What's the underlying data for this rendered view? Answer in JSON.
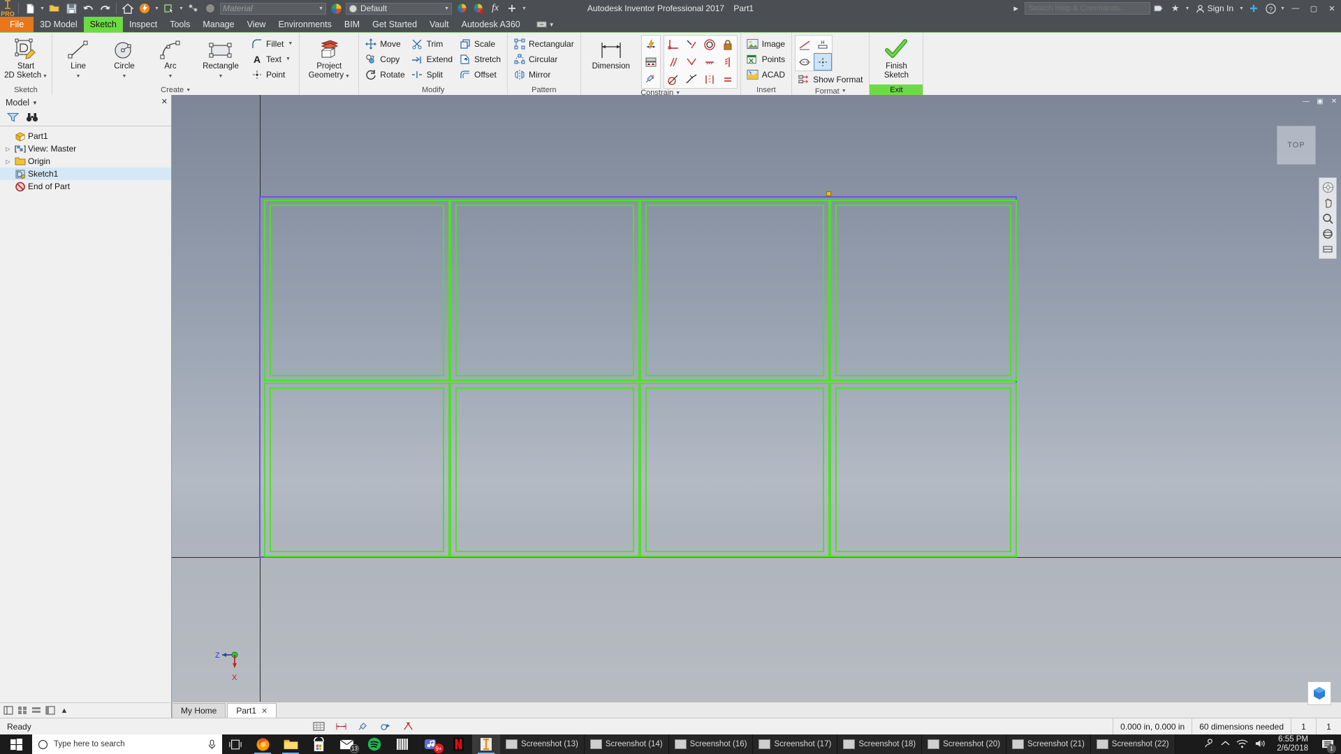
{
  "app": {
    "title": "Autodesk Inventor Professional 2017",
    "document": "Part1",
    "logo": "PRO"
  },
  "quick_access": {
    "icons": [
      "new-document-icon",
      "open-folder-icon",
      "save-icon",
      "undo-icon",
      "redo-icon",
      "home-icon",
      "update-icon",
      "select-icon",
      "constraint-icon",
      "appearance-sphere-icon"
    ],
    "material_placeholder": "Material",
    "appearance_value": "Default",
    "fx_label": "fx"
  },
  "search": {
    "placeholder": "Search Help & Commands...",
    "sign_in": "Sign In"
  },
  "tabs": [
    {
      "label": "File",
      "state": "file"
    },
    {
      "label": "3D Model",
      "state": "normal"
    },
    {
      "label": "Sketch",
      "state": "active"
    },
    {
      "label": "Inspect",
      "state": "normal"
    },
    {
      "label": "Tools",
      "state": "normal"
    },
    {
      "label": "Manage",
      "state": "normal"
    },
    {
      "label": "View",
      "state": "normal"
    },
    {
      "label": "Environments",
      "state": "normal"
    },
    {
      "label": "BIM",
      "state": "normal"
    },
    {
      "label": "Get Started",
      "state": "normal"
    },
    {
      "label": "Vault",
      "state": "normal"
    },
    {
      "label": "Autodesk A360",
      "state": "normal"
    }
  ],
  "ribbon": {
    "groups": {
      "sketch": {
        "label": "Sketch",
        "start_2d_sketch": "Start\n2D Sketch",
        "start_line1": "Start",
        "start_line2": "2D Sketch"
      },
      "create": {
        "label": "Create",
        "line": "Line",
        "circle": "Circle",
        "arc": "Arc",
        "rectangle": "Rectangle",
        "fillet": "Fillet",
        "text": "Text",
        "point": "Point"
      },
      "project": {
        "line1": "Project",
        "line2": "Geometry"
      },
      "modify": {
        "label": "Modify",
        "move": "Move",
        "copy": "Copy",
        "rotate": "Rotate",
        "trim": "Trim",
        "extend": "Extend",
        "split": "Split",
        "scale": "Scale",
        "stretch": "Stretch",
        "offset": "Offset"
      },
      "pattern": {
        "label": "Pattern",
        "rectangular": "Rectangular",
        "circular": "Circular",
        "mirror": "Mirror"
      },
      "constrain": {
        "label": "Constrain",
        "dimension": "Dimension"
      },
      "insert": {
        "label": "Insert",
        "image": "Image",
        "points": "Points",
        "acad": "ACAD"
      },
      "format": {
        "label": "Format",
        "show_format": "Show Format"
      },
      "exit": {
        "label": "Exit",
        "finish_line1": "Finish",
        "finish_line2": "Sketch"
      }
    }
  },
  "browser": {
    "title": "Model",
    "filter_icon": "filter-icon",
    "find_icon": "binoculars-icon",
    "tree": [
      {
        "label": "Part1",
        "icon": "part-cube-icon",
        "indent": 0,
        "expandable": false,
        "selected": false
      },
      {
        "label": "View: Master",
        "icon": "view-master-icon",
        "indent": 0,
        "expandable": true,
        "selected": false
      },
      {
        "label": "Origin",
        "icon": "folder-icon",
        "indent": 0,
        "expandable": true,
        "selected": false
      },
      {
        "label": "Sketch1",
        "icon": "sketch-icon",
        "indent": 0,
        "expandable": false,
        "selected": true
      },
      {
        "label": "End of Part",
        "icon": "end-of-part-icon",
        "indent": 0,
        "expandable": false,
        "selected": false
      }
    ]
  },
  "canvas": {
    "view_cube_label": "TOP",
    "axis_z": "Z",
    "axis_x": "X",
    "nav_icons": [
      "full-navigation-wheel-icon",
      "pan-icon",
      "zoom-icon",
      "orbit-icon",
      "look-at-icon"
    ]
  },
  "doc_tabs": [
    {
      "label": "My Home",
      "active": false,
      "closable": false
    },
    {
      "label": "Part1",
      "active": true,
      "closable": true
    }
  ],
  "status": {
    "ready": "Ready",
    "coordinates": "0.000 in, 0.000 in",
    "dimensions_needed": "60 dimensions needed",
    "count_a": "1",
    "count_b": "1"
  },
  "taskbar": {
    "search_placeholder": "Type here to search",
    "apps": [
      "task-view-icon",
      "firefox-icon",
      "file-explorer-icon",
      "microsoft-store-icon",
      "mail-icon",
      "spotify-icon",
      "books-icon",
      "music-icon",
      "netflix-icon",
      "inventor-icon"
    ],
    "mail_badge": "13",
    "music_badge": "9+",
    "windows": [
      {
        "label": "Screenshot (13)",
        "active": false
      },
      {
        "label": "Screenshot (14)",
        "active": false
      },
      {
        "label": "Screenshot (16)",
        "active": false
      },
      {
        "label": "Screenshot (17)",
        "active": false
      },
      {
        "label": "Screenshot (18)",
        "active": false
      },
      {
        "label": "Screenshot (20)",
        "active": false
      },
      {
        "label": "Screenshot (21)",
        "active": false
      },
      {
        "label": "Screenshot (22)",
        "active": false
      }
    ],
    "time": "6:55 PM",
    "date": "2/6/2018",
    "notification_count": "1"
  }
}
